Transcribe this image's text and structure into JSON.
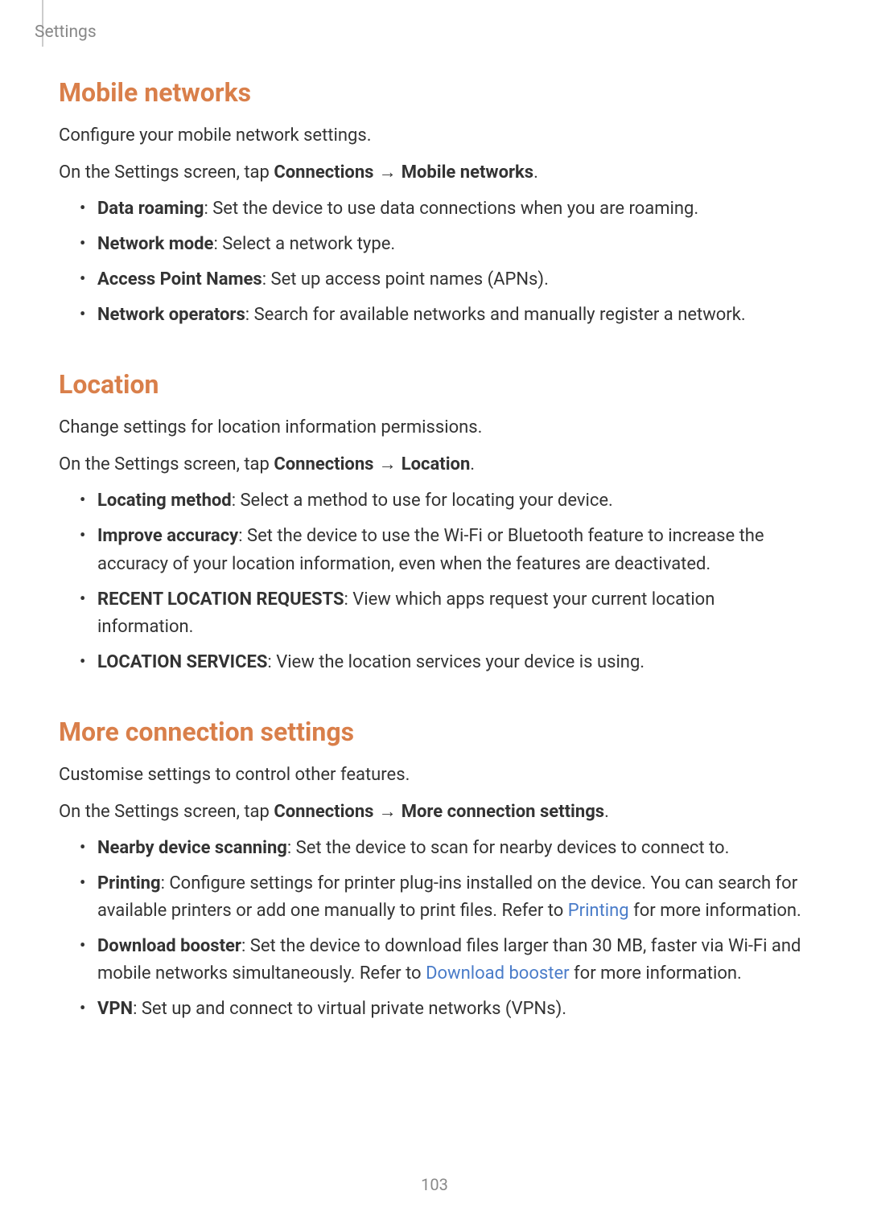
{
  "header": {
    "breadcrumb": "Settings"
  },
  "sections": {
    "mobileNetworks": {
      "title": "Mobile networks",
      "intro": "Configure your mobile network settings.",
      "nav_prefix": "On the Settings screen, tap ",
      "nav_bold1": "Connections",
      "nav_arrow": " → ",
      "nav_bold2": "Mobile networks",
      "nav_suffix": ".",
      "items": [
        {
          "bold": "Data roaming",
          "text": ": Set the device to use data connections when you are roaming."
        },
        {
          "bold": "Network mode",
          "text": ": Select a network type."
        },
        {
          "bold": "Access Point Names",
          "text": ": Set up access point names (APNs)."
        },
        {
          "bold": "Network operators",
          "text": ": Search for available networks and manually register a network."
        }
      ]
    },
    "location": {
      "title": "Location",
      "intro": "Change settings for location information permissions.",
      "nav_prefix": "On the Settings screen, tap ",
      "nav_bold1": "Connections",
      "nav_arrow": " → ",
      "nav_bold2": "Location",
      "nav_suffix": ".",
      "items": [
        {
          "bold": "Locating method",
          "text": ": Select a method to use for locating your device."
        },
        {
          "bold": "Improve accuracy",
          "text": ": Set the device to use the Wi-Fi or Bluetooth feature to increase the accuracy of your location information, even when the features are deactivated."
        },
        {
          "bold": "RECENT LOCATION REQUESTS",
          "text": ": View which apps request your current location information."
        },
        {
          "bold": "LOCATION SERVICES",
          "text": ": View the location services your device is using."
        }
      ]
    },
    "moreConnection": {
      "title": "More connection settings",
      "intro": "Customise settings to control other features.",
      "nav_prefix": "On the Settings screen, tap ",
      "nav_bold1": "Connections",
      "nav_arrow": " → ",
      "nav_bold2": "More connection settings",
      "nav_suffix": ".",
      "items": {
        "nearby": {
          "bold": "Nearby device scanning",
          "text": ": Set the device to scan for nearby devices to connect to."
        },
        "printing": {
          "bold": "Printing",
          "text1": ": Configure settings for printer plug-ins installed on the device. You can search for available printers or add one manually to print files. Refer to ",
          "link": "Printing",
          "text2": " for more information."
        },
        "download": {
          "bold": "Download booster",
          "text1": ": Set the device to download files larger than 30 MB, faster via Wi-Fi and mobile networks simultaneously. Refer to ",
          "link": "Download booster",
          "text2": " for more information."
        },
        "vpn": {
          "bold": "VPN",
          "text": ": Set up and connect to virtual private networks (VPNs)."
        }
      }
    }
  },
  "pageNumber": "103"
}
